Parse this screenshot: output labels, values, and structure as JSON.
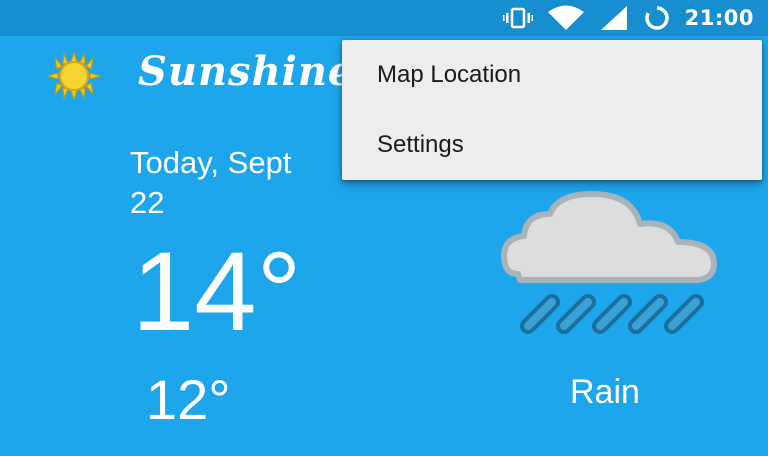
{
  "status_bar": {
    "time": "21:00",
    "icons": [
      "vibrate-icon",
      "wifi-icon",
      "signal-icon",
      "battery-loading-icon"
    ]
  },
  "app_bar": {
    "title": "Sunshine",
    "logo_icon": "sun-icon"
  },
  "today": {
    "date_line1": "Today, Sept",
    "date_line2": "22",
    "high": "14°",
    "low": "12°",
    "condition": "Rain",
    "condition_icon": "rain-cloud-icon"
  },
  "overflow_menu": {
    "items": [
      {
        "label": "Map Location"
      },
      {
        "label": "Settings"
      }
    ]
  },
  "colors": {
    "background": "#1ea6ec",
    "status_bar": "#168ed0",
    "menu_background": "#ededed",
    "text": "#ffffff"
  }
}
